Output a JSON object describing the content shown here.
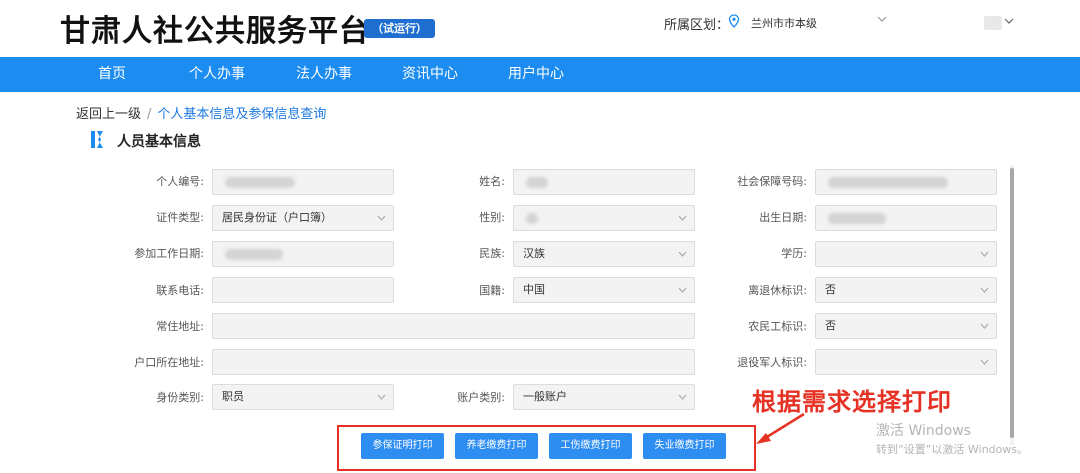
{
  "header": {
    "brand": "甘肃人社公共服务平台",
    "trial_badge": "（试运行）",
    "region_label": "所属区划：",
    "region_value": "兰州市市本级"
  },
  "nav": {
    "items": [
      "首页",
      "个人办事",
      "法人办事",
      "资讯中心",
      "用户中心"
    ]
  },
  "breadcrumb": {
    "back": "返回上一级",
    "separator": "/",
    "current": "个人基本信息及参保信息查询"
  },
  "section": {
    "title": "人员基本信息"
  },
  "form": {
    "fields": [
      {
        "label": "个人编号:",
        "value": "",
        "blurred": true
      },
      {
        "label": "姓名:",
        "value": "",
        "blurred": true
      },
      {
        "label": "社会保障号码:",
        "value": "",
        "blurred": true
      },
      {
        "label": "证件类型:",
        "value": "居民身份证（户口簿）"
      },
      {
        "label": "性别:",
        "value": "",
        "blurred": true
      },
      {
        "label": "出生日期:",
        "value": "",
        "blurred": true
      },
      {
        "label": "参加工作日期:",
        "value": "",
        "blurred": true
      },
      {
        "label": "民族:",
        "value": "汉族"
      },
      {
        "label": "学历:",
        "value": ""
      },
      {
        "label": "联系电话:",
        "value": ""
      },
      {
        "label": "国籍:",
        "value": "中国"
      },
      {
        "label": "离退休标识:",
        "value": "否"
      },
      {
        "label": "常住地址:",
        "value": ""
      },
      {
        "label": "农民工标识:",
        "value": "否"
      },
      {
        "label": "户口所在地址:",
        "value": ""
      },
      {
        "label": "退役军人标识:",
        "value": ""
      },
      {
        "label": "身份类别:",
        "value": "职员"
      },
      {
        "label": "账户类别:",
        "value": "一般账户"
      }
    ]
  },
  "print_buttons": [
    "参保证明打印",
    "养老缴费打印",
    "工伤缴费打印",
    "失业缴费打印"
  ],
  "annotation": "根据需求选择打印",
  "watermark": {
    "title": "激活 Windows",
    "subtitle": "转到“设置”以激活 Windows。"
  },
  "colors": {
    "nav_bg": "#1c8cf1",
    "button_bg": "#2d8df0",
    "annotation_red": "#e53224",
    "link_blue": "#1c78e0"
  }
}
